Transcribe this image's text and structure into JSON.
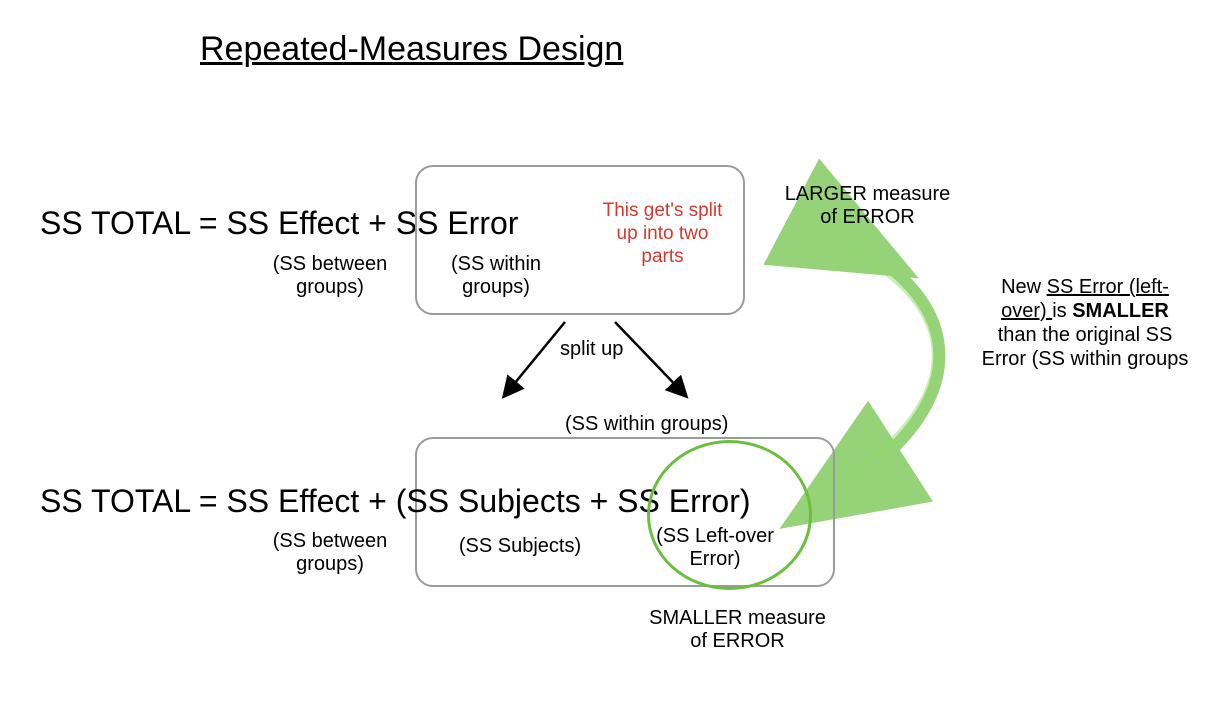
{
  "title": "Repeated-Measures Design",
  "eq1": {
    "full": "SS TOTAL = SS Effect + SS Error",
    "between_note": "(SS between groups)",
    "within_note": "(SS within groups)"
  },
  "eq2": {
    "full": "SS TOTAL = SS Effect + (SS Subjects + SS Error)",
    "between_note": "(SS between groups)",
    "subjects_note": "(SS Subjects)",
    "leftover_note": "(SS Left-over Error)",
    "within_note": "(SS within groups)"
  },
  "red_note": "This get's split up into two parts",
  "split_label": "split up",
  "larger_label": "LARGER measure of ERROR",
  "smaller_label": "SMALLER measure of ERROR",
  "side_paragraph": {
    "part1": "New ",
    "ul1": "SS Error (left-over) ",
    "part2": "is ",
    "bold": "SMALLER",
    "part3": " than the original SS Error (SS within groups"
  }
}
